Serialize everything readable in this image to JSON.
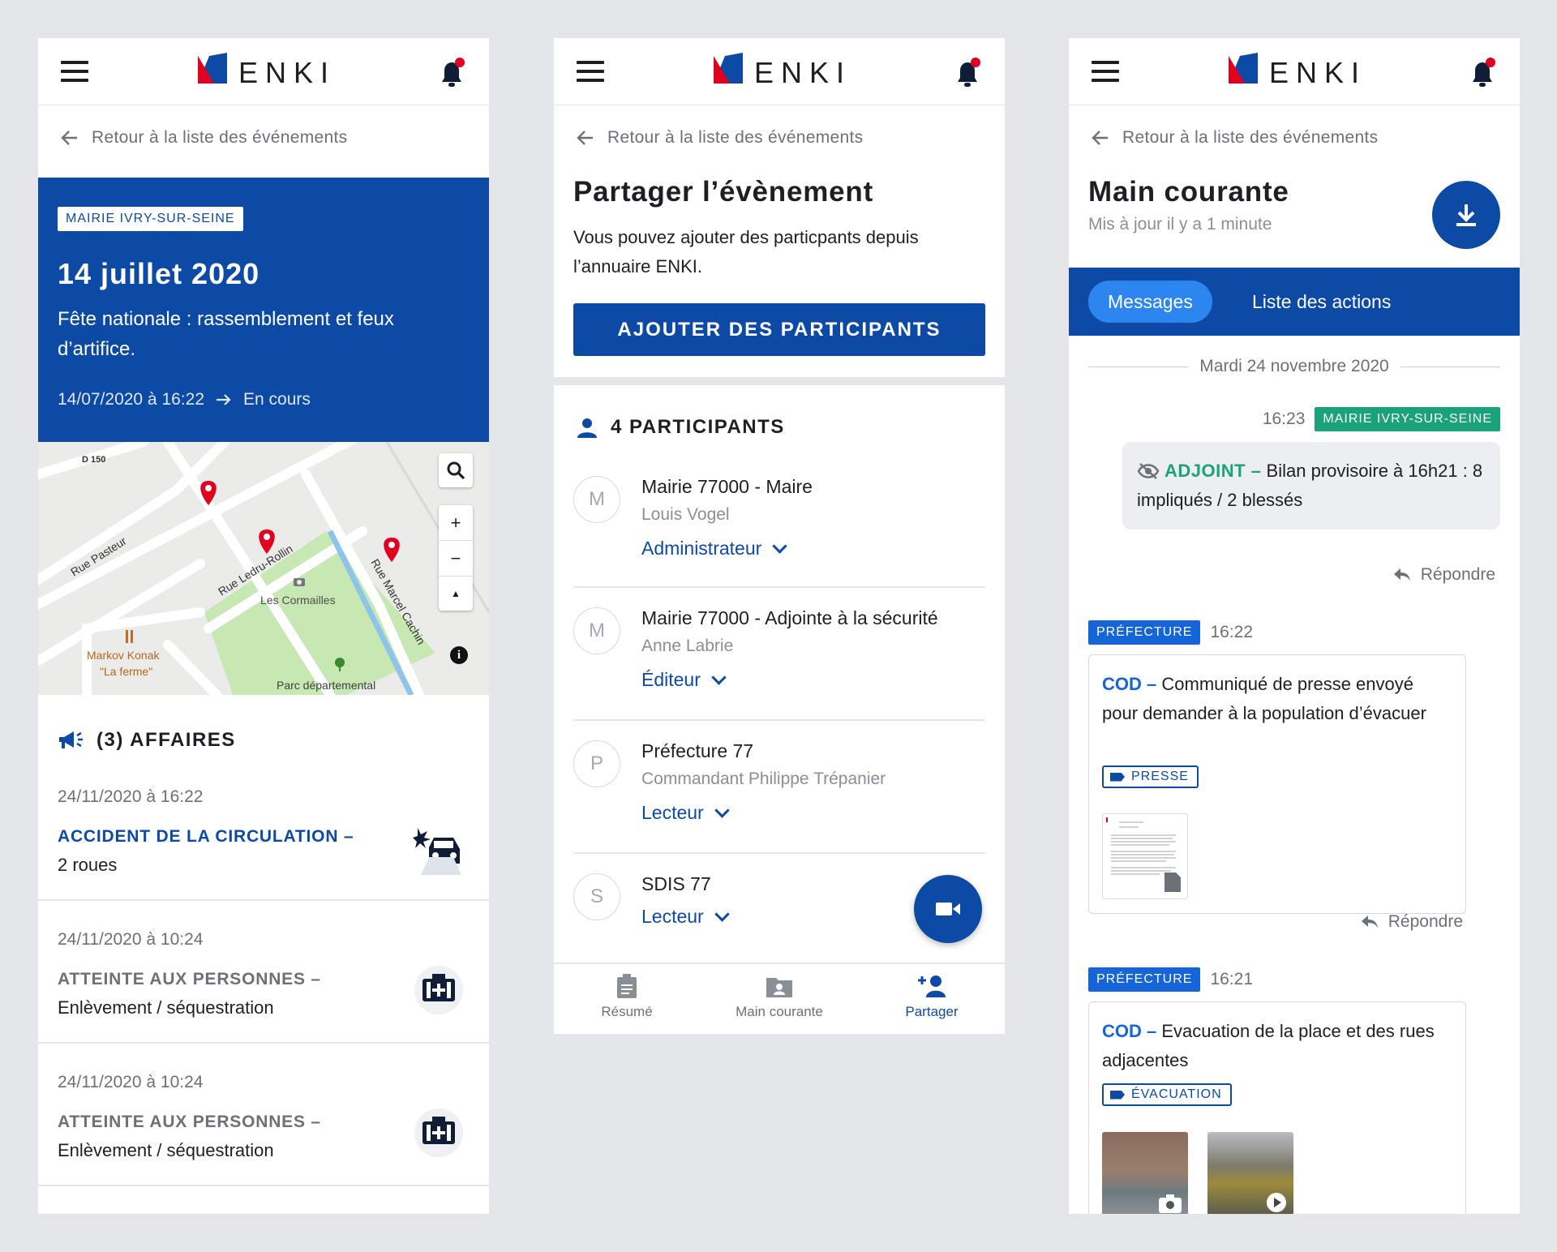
{
  "app": {
    "logo_text": "ENKI"
  },
  "colors": {
    "primary": "#0c4aa6",
    "alert_red": "#e1001f",
    "green": "#1aa37a",
    "light_blue": "#1565d8"
  },
  "back_label": "Retour à la liste des événements",
  "event": {
    "org_tag": "MAIRIE IVRY-SUR-SEINE",
    "title": "14 juillet 2020",
    "description": "Fête nationale : rassemblement et feux d’artifice.",
    "start": "14/07/2020 à 16:22",
    "status": "En cours"
  },
  "map": {
    "road_label": "D 150",
    "streets": [
      "Rue Pasteur",
      "Rue Ledru-Rollin",
      "Rue Marcel Cachin"
    ],
    "places": [
      "Les Cormailles",
      "Markov Konak",
      "\"La ferme\"",
      "Parc départemental"
    ],
    "icons": [
      "search-icon",
      "zoom-in-icon",
      "zoom-out-icon",
      "compass-icon",
      "info-icon"
    ]
  },
  "affaires": {
    "title": "(3) AFFAIRES",
    "items": [
      {
        "date": "24/11/2020 à 16:22",
        "category": "ACCIDENT DE LA CIRCULATION –",
        "subtitle": "2 roues",
        "icon": "car-crash-icon"
      },
      {
        "date": "24/11/2020 à 10:24",
        "category": "ATTEINTE AUX PERSONNES –",
        "subtitle": "Enlèvement / séquestration",
        "icon": "first-aid-icon"
      },
      {
        "date": "24/11/2020 à 10:24",
        "category": "ATTEINTE AUX PERSONNES –",
        "subtitle": "Enlèvement / séquestration",
        "icon": "first-aid-icon"
      }
    ]
  },
  "share": {
    "title": "Partager l’évènement",
    "description": "Vous pouvez ajouter des particpants depuis l’annuaire ENKI.",
    "button": "AJOUTER DES PARTICIPANTS",
    "participants_title": "4 PARTICIPANTS",
    "participants": [
      {
        "initial": "M",
        "name": "Mairie 77000 - Maire",
        "person": "Louis Vogel",
        "role": "Administrateur"
      },
      {
        "initial": "M",
        "name": "Mairie 77000 - Adjointe à la sécurité",
        "person": "Anne Labrie",
        "role": "Éditeur"
      },
      {
        "initial": "P",
        "name": "Préfecture 77",
        "person": "Commandant Philippe Trépanier",
        "role": "Lecteur"
      },
      {
        "initial": "S",
        "name": "SDIS 77",
        "person": "",
        "role": "Lecteur"
      }
    ]
  },
  "bottom_nav": {
    "tabs": [
      "Résumé",
      "Main courante",
      "Partager"
    ],
    "active": "Partager"
  },
  "main_courante": {
    "title": "Main courante",
    "updated": "Mis à jour il y a 1 minute",
    "tabs": [
      "Messages",
      "Liste des actions"
    ],
    "active_tab": "Messages",
    "date_separator": "Mardi 24 novembre 2020",
    "reply_label": "Répondre",
    "msg1": {
      "time": "16:23",
      "org": "MAIRIE IVRY-SUR-SEINE",
      "author": "ADJOINT –",
      "text": "Bilan provisoire à 16h21 : 8 impliqués / 2 blessés"
    },
    "msg2": {
      "org": "PRÉFECTURE",
      "time": "16:22",
      "author": "COD –",
      "text": "Communiqué de presse envoyé pour demander à la population d’évacuer",
      "tag": "PRESSE"
    },
    "msg3": {
      "org": "PRÉFECTURE",
      "time": "16:21",
      "author": "COD –",
      "text": "Evacuation de la place et des rues adjacentes",
      "tag": "ÉVACUATION"
    }
  }
}
